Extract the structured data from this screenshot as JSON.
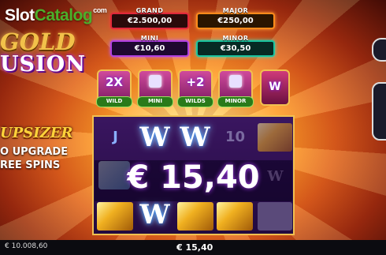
{
  "watermark": {
    "part1": "Slot",
    "part2": "Catalog",
    "domain": "com"
  },
  "logo": {
    "line1": "GOLD",
    "line2": "USION"
  },
  "promo": {
    "line1": "UPSIZER",
    "line2": "O UPGRADE",
    "line3": "REE SPINS"
  },
  "jackpots": {
    "grand": {
      "label": "GRAND",
      "value": "€2.500,00"
    },
    "major": {
      "label": "MAJOR",
      "value": "€250,00"
    },
    "mini": {
      "label": "MINI",
      "value": "€10,60"
    },
    "minor": {
      "label": "MINOR",
      "value": "€30,50"
    }
  },
  "features": [
    {
      "icon": "2X",
      "tag": "WILD"
    },
    {
      "icon": "lock-icon",
      "tag": "MINI"
    },
    {
      "icon": "+2",
      "tag": "WILDS"
    },
    {
      "icon": "lock-icon",
      "tag": "MINOR"
    }
  ],
  "reels": {
    "symbol_j": "J",
    "wild": "W",
    "ten": "10"
  },
  "win_display": "€ 15,40",
  "bottom_bar": {
    "balance": "€ 10.008,60",
    "win": "€ 15,40"
  }
}
